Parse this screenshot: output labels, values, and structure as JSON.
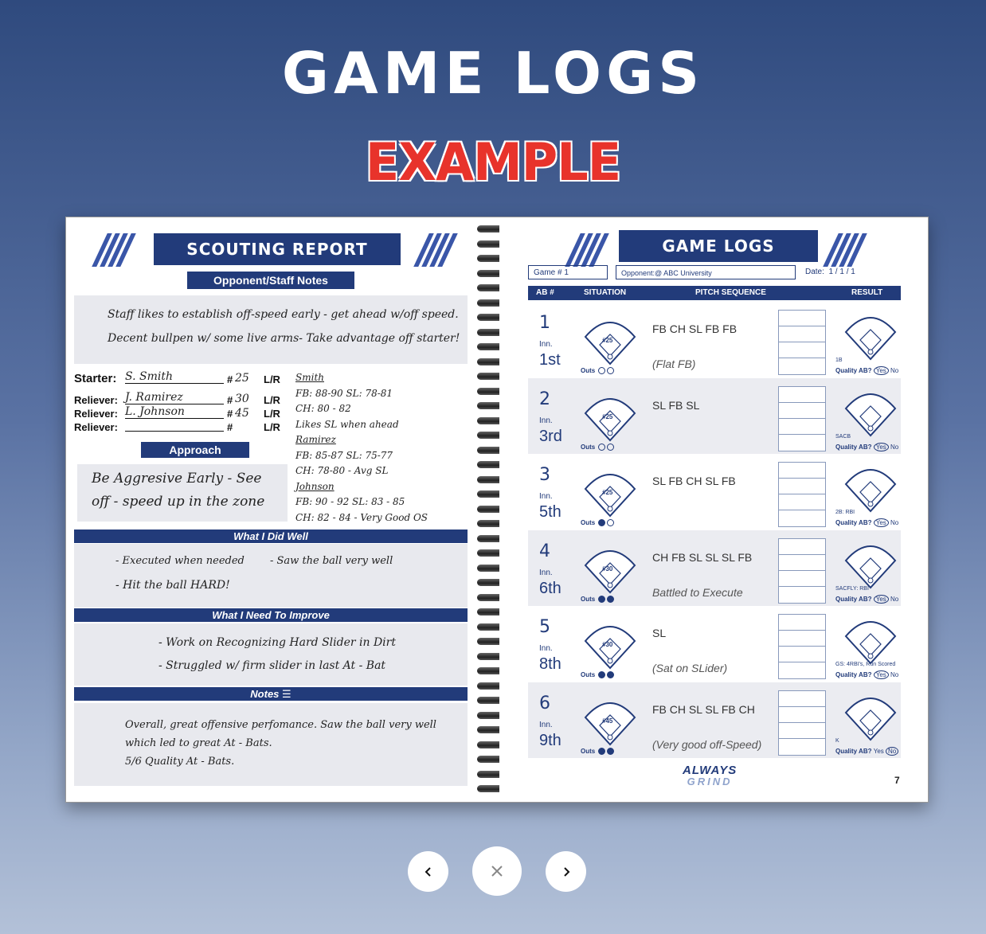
{
  "header": {
    "title": "GAME LOGS",
    "subtitle": "EXAMPLE"
  },
  "left_page": {
    "header": "SCOUTING REPORT",
    "subheader": "Opponent/Staff Notes",
    "staff_notes": [
      "Staff likes to establish off-speed early - get ahead w/off speed.",
      "Decent bullpen w/ some live arms- Take advantage off starter!"
    ],
    "pitchers": [
      {
        "role": "Starter:",
        "name": "S. Smith",
        "num": "25",
        "hand": "L/R"
      },
      {
        "role": "Reliever:",
        "name": "J. Ramirez",
        "num": "30",
        "hand": "L/R"
      },
      {
        "role": "Reliever:",
        "name": "L. Johnson",
        "num": "45",
        "hand": "L/R"
      },
      {
        "role": "Reliever:",
        "name": "",
        "num": "",
        "hand": "L/R"
      }
    ],
    "hash": "#",
    "pitcher_notes": [
      "Smith",
      "FB: 88-90  SL: 78-81",
      "CH: 80 - 82",
      "Likes SL when ahead",
      "Ramirez",
      "FB: 85-87  SL: 75-77",
      "CH: 78-80  - Avg SL",
      "Johnson",
      "FB: 90 - 92  SL: 83 - 85",
      "CH: 82 - 84  - Very Good OS"
    ],
    "approach_label": "Approach",
    "approach_text": [
      "Be Aggresive Early - See",
      "off - speed up in the zone"
    ],
    "did_well_label": "What I Did Well",
    "did_well": [
      "- Executed when needed",
      "- Saw the ball very well",
      "- Hit the ball HARD!"
    ],
    "improve_label": "What I Need To Improve",
    "improve": [
      "- Work on Recognizing Hard Slider in Dirt",
      "- Struggled w/ firm slider in last At - Bat"
    ],
    "notes_label": "Notes",
    "notes": [
      "Overall, great offensive perfomance. Saw the ball very well",
      "which led to great At - Bats.",
      "5/6 Quality At - Bats."
    ]
  },
  "right_page": {
    "header": "GAME LOGS",
    "game_label": "Game #",
    "game_value": "1",
    "opponent_label": "Opponent:",
    "opponent_value": "@ ABC University",
    "date_label": "Date:",
    "date_value": [
      "1",
      "1",
      "1"
    ],
    "columns": [
      "AB #",
      "SITUATION",
      "PITCH SEQUENCE",
      "RESULT"
    ],
    "inn_label": "Inn.",
    "outs_label": "Outs",
    "quality_label": "Quality AB?",
    "yes": "Yes",
    "no": "No",
    "at_bats": [
      {
        "ab": "1",
        "inning": "1st",
        "num": "#25",
        "outs": 0,
        "seq": "FB CH SL FB FB",
        "note": "(Flat FB)",
        "result": "1B",
        "quality": "Yes"
      },
      {
        "ab": "2",
        "inning": "3rd",
        "num": "#25",
        "outs": 0,
        "seq": "SL FB SL",
        "note": "",
        "result": "SACB",
        "quality": "Yes"
      },
      {
        "ab": "3",
        "inning": "5th",
        "num": "#25",
        "outs": 1,
        "seq": "SL FB CH SL FB",
        "note": "",
        "result": "2B: RBI",
        "quality": "Yes"
      },
      {
        "ab": "4",
        "inning": "6th",
        "num": "#30",
        "outs": 2,
        "seq": "CH FB SL SL SL FB",
        "note": "Battled to Execute",
        "result": "SACFLY: RBI",
        "quality": "Yes"
      },
      {
        "ab": "5",
        "inning": "8th",
        "num": "#30",
        "outs": 2,
        "seq": "SL",
        "note": "(Sat on SLider)",
        "result": "GS: 4RBI's, Run Scored",
        "quality": "Yes"
      },
      {
        "ab": "6",
        "inning": "9th",
        "num": "#45",
        "outs": 2,
        "seq": "FB CH SL SL FB CH",
        "note": "(Very good off-Speed)",
        "result": "K",
        "quality": "No"
      }
    ],
    "brand_line1": "ALWAYS",
    "brand_line2": "GRIND",
    "page_number": "7"
  },
  "controls": {
    "prev_icon": "chevron-left-icon",
    "close_icon": "close-icon",
    "next_icon": "chevron-right-icon"
  },
  "colors": {
    "navy": "#223b7a",
    "red": "#e8332b"
  }
}
